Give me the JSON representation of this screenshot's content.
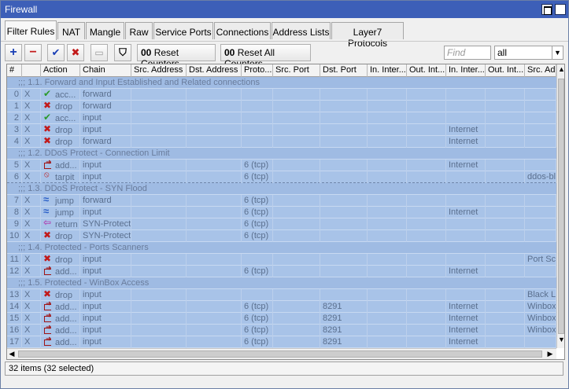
{
  "window": {
    "title": "Firewall"
  },
  "tabs": [
    "Filter Rules",
    "NAT",
    "Mangle",
    "Raw",
    "Service Ports",
    "Connections",
    "Address Lists",
    "Layer7 Protocols"
  ],
  "toolbar": {
    "reset_counters": "Reset Counters",
    "reset_all_counters": "Reset All Counters",
    "counter_prefix": "00",
    "find_placeholder": "Find",
    "filter_value": "all"
  },
  "columns": [
    "#",
    "",
    "Action",
    "Chain",
    "Src. Address",
    "Dst. Address",
    "Proto...",
    "Src. Port",
    "Dst. Port",
    "In. Inter...",
    "Out. Int...",
    "In. Inter...",
    "Out. Int...",
    "Src. Ad"
  ],
  "rows": [
    {
      "type": "comment",
      "text": ";;; 1.1. Forward and Input Established and Related connections"
    },
    {
      "type": "rule",
      "num": "0",
      "flag": "X",
      "icon": "check",
      "action": "acc...",
      "chain": "forward",
      "proto": "",
      "dst_port": "",
      "in_if_list": "",
      "src_list": ""
    },
    {
      "type": "rule",
      "num": "1",
      "flag": "X",
      "icon": "cross",
      "action": "drop",
      "chain": "forward",
      "proto": "",
      "dst_port": "",
      "in_if_list": "",
      "src_list": ""
    },
    {
      "type": "rule",
      "num": "2",
      "flag": "X",
      "icon": "check",
      "action": "acc...",
      "chain": "input",
      "proto": "",
      "dst_port": "",
      "in_if_list": "",
      "src_list": ""
    },
    {
      "type": "rule",
      "num": "3",
      "flag": "X",
      "icon": "cross",
      "action": "drop",
      "chain": "input",
      "proto": "",
      "dst_port": "",
      "in_if_list": "Internet",
      "src_list": ""
    },
    {
      "type": "rule",
      "num": "4",
      "flag": "X",
      "icon": "cross",
      "action": "drop",
      "chain": "forward",
      "proto": "",
      "dst_port": "",
      "in_if_list": "Internet",
      "src_list": ""
    },
    {
      "type": "comment",
      "text": ";;; 1.2. DDoS Protect - Connection Limit"
    },
    {
      "type": "rule",
      "num": "5",
      "flag": "X",
      "icon": "add",
      "action": "add...",
      "chain": "input",
      "proto": "6 (tcp)",
      "dst_port": "",
      "in_if_list": "Internet",
      "src_list": ""
    },
    {
      "type": "rule",
      "num": "6",
      "flag": "X",
      "icon": "tarpit",
      "action": "tarpit",
      "chain": "input",
      "proto": "6 (tcp)",
      "dst_port": "",
      "in_if_list": "",
      "src_list": "ddos-bl"
    },
    {
      "type": "comment",
      "text": ";;; 1.3. DDoS Protect - SYN Flood"
    },
    {
      "type": "rule",
      "num": "7",
      "flag": "X",
      "icon": "jump",
      "action": "jump",
      "chain": "forward",
      "proto": "6 (tcp)",
      "dst_port": "",
      "in_if_list": "",
      "src_list": ""
    },
    {
      "type": "rule",
      "num": "8",
      "flag": "X",
      "icon": "jump",
      "action": "jump",
      "chain": "input",
      "proto": "6 (tcp)",
      "dst_port": "",
      "in_if_list": "Internet",
      "src_list": ""
    },
    {
      "type": "rule",
      "num": "9",
      "flag": "X",
      "icon": "return",
      "action": "return",
      "chain": "SYN-Protect",
      "proto": "6 (tcp)",
      "dst_port": "",
      "in_if_list": "",
      "src_list": ""
    },
    {
      "type": "rule",
      "num": "10",
      "flag": "X",
      "icon": "cross",
      "action": "drop",
      "chain": "SYN-Protect",
      "proto": "6 (tcp)",
      "dst_port": "",
      "in_if_list": "",
      "src_list": ""
    },
    {
      "type": "comment",
      "text": ";;; 1.4. Protected - Ports Scanners"
    },
    {
      "type": "rule",
      "num": "11",
      "flag": "X",
      "icon": "cross",
      "action": "drop",
      "chain": "input",
      "proto": "",
      "dst_port": "",
      "in_if_list": "",
      "src_list": "Port Sc"
    },
    {
      "type": "rule",
      "num": "12",
      "flag": "X",
      "icon": "add",
      "action": "add...",
      "chain": "input",
      "proto": "6 (tcp)",
      "dst_port": "",
      "in_if_list": "Internet",
      "src_list": ""
    },
    {
      "type": "comment",
      "text": ";;; 1.5. Protected - WinBox Access"
    },
    {
      "type": "rule",
      "num": "13",
      "flag": "X",
      "icon": "cross",
      "action": "drop",
      "chain": "input",
      "proto": "",
      "dst_port": "",
      "in_if_list": "",
      "src_list": "Black L"
    },
    {
      "type": "rule",
      "num": "14",
      "flag": "X",
      "icon": "add",
      "action": "add...",
      "chain": "input",
      "proto": "6 (tcp)",
      "dst_port": "8291",
      "in_if_list": "Internet",
      "src_list": "Winbox"
    },
    {
      "type": "rule",
      "num": "15",
      "flag": "X",
      "icon": "add",
      "action": "add...",
      "chain": "input",
      "proto": "6 (tcp)",
      "dst_port": "8291",
      "in_if_list": "Internet",
      "src_list": "Winbox"
    },
    {
      "type": "rule",
      "num": "16",
      "flag": "X",
      "icon": "add",
      "action": "add...",
      "chain": "input",
      "proto": "6 (tcp)",
      "dst_port": "8291",
      "in_if_list": "Internet",
      "src_list": "Winbox"
    },
    {
      "type": "rule",
      "num": "17",
      "flag": "X",
      "icon": "add",
      "action": "add...",
      "chain": "input",
      "proto": "6 (tcp)",
      "dst_port": "8291",
      "in_if_list": "Internet",
      "src_list": ""
    }
  ],
  "status": {
    "text": "32 items (32 selected)"
  },
  "colors": {
    "titlebar": "#3d5fb8",
    "row_selected": "#a8c3e8",
    "text_disabled": "#5a6f8e"
  }
}
